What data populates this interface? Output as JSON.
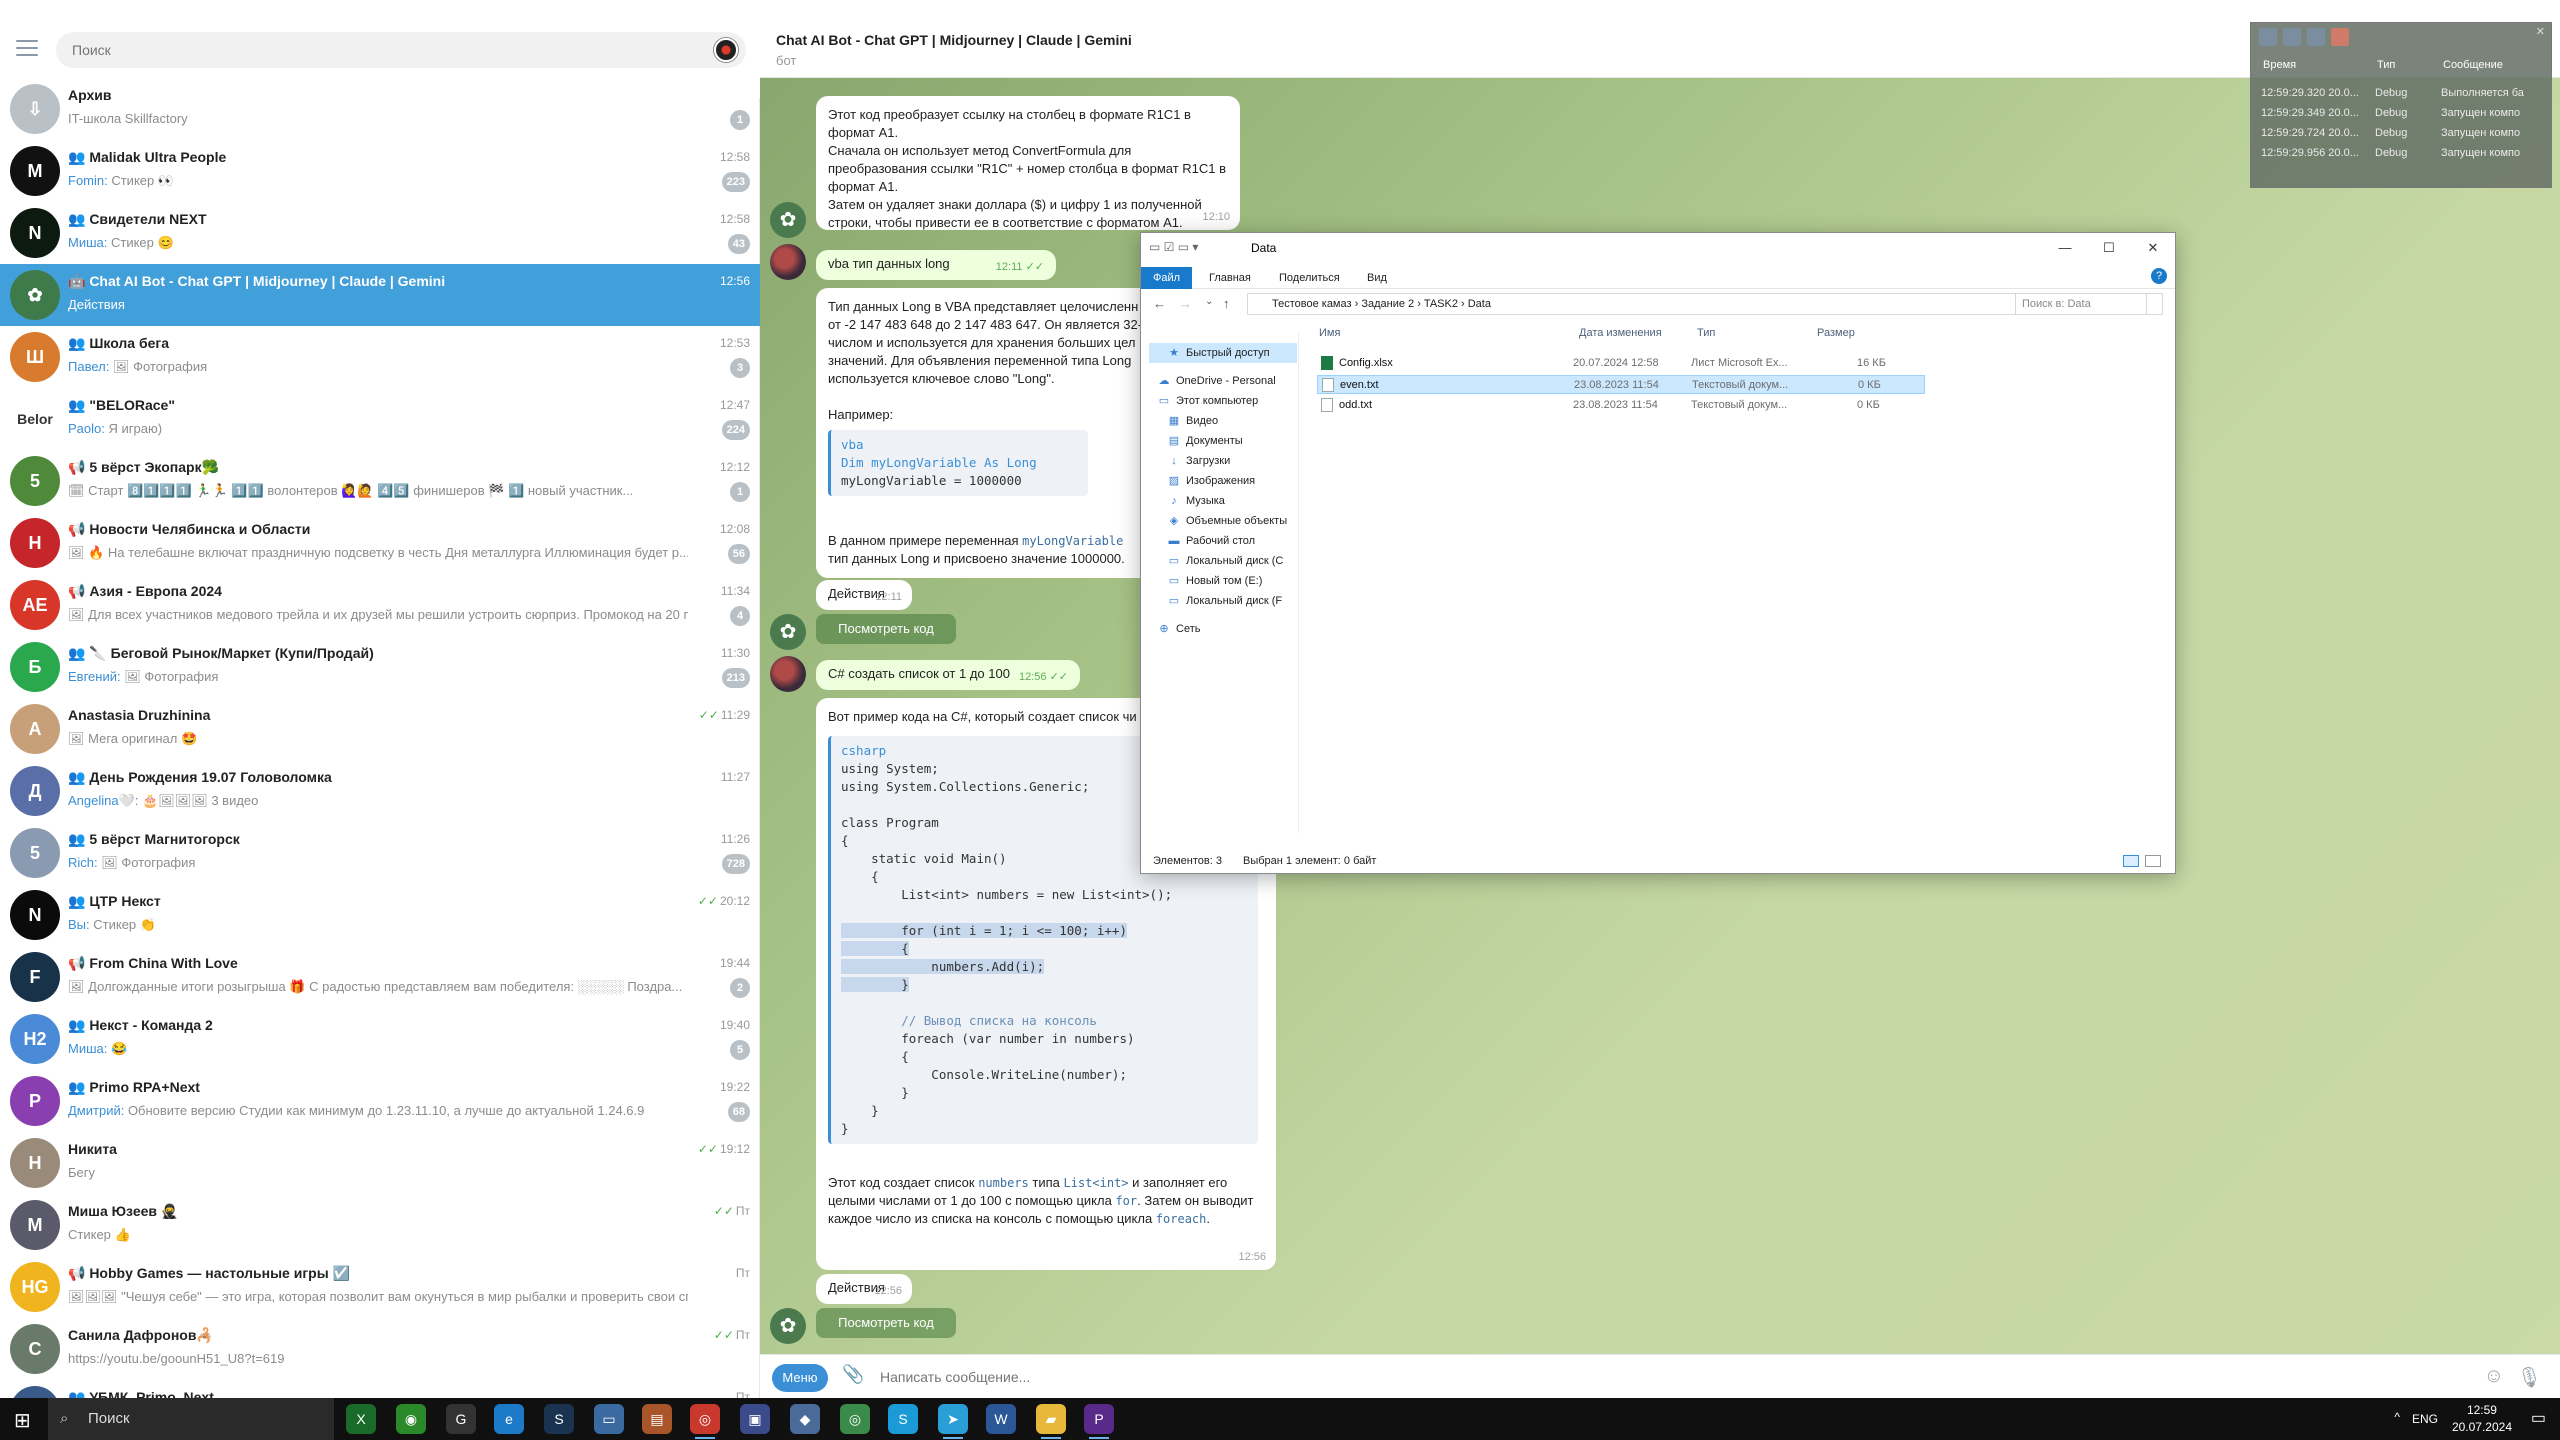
{
  "sidebar": {
    "search_placeholder": "Поиск",
    "chats": [
      {
        "name": "Архив",
        "time": "",
        "sender": "",
        "preview": "IT-школа Skillfactory",
        "badge": "1",
        "avatar_color": "#b9c1c6",
        "avatar_text": "⇩"
      },
      {
        "name": "👥 Malidak Ultra People",
        "time": "12:58",
        "sender": "Fomin: ",
        "preview": "Стикер 👀",
        "badge": "223",
        "avatar_color": "#111111",
        "avatar_text": "M"
      },
      {
        "name": "👥 Свидетели NEXT",
        "time": "12:58",
        "sender": "Миша: ",
        "preview": "Стикер 😊",
        "badge": "43",
        "avatar_color": "#0d1a10",
        "avatar_text": "N"
      },
      {
        "name": "🤖 Chat AI Bot - Chat GPT | Midjourney | Claude | Gemini",
        "time": "12:56",
        "sender": "",
        "preview": "Действия",
        "badge": "",
        "avatar_color": "#3e7a4a",
        "avatar_text": "✿",
        "active": true
      },
      {
        "name": "👥 Школа бега",
        "time": "12:53",
        "sender": "Павел: ",
        "preview": "🖼 Фотография",
        "badge": "3",
        "avatar_color": "#d97b2e",
        "avatar_text": "Ш"
      },
      {
        "name": "👥 \"BELORace\"",
        "time": "12:47",
        "sender": "Paolo: ",
        "preview": "Я играю)",
        "badge": "224",
        "avatar_color": "#ffffff",
        "avatar_text": "Belor"
      },
      {
        "name": "📢 5 вёрст Экопарк🥦",
        "time": "12:12",
        "sender": "",
        "preview": "🗓 Старт 8️⃣1️⃣1️⃣1️⃣ 🏃‍♂️🏃 1️⃣1️⃣ волонтеров 🙋‍♀️🙋 4️⃣5️⃣ финишеров 🏁 1️⃣ новый участник...",
        "badge": "1",
        "avatar_color": "#4f8a3a",
        "avatar_text": "5"
      },
      {
        "name": "📢 Новости Челябинска и Области",
        "time": "12:08",
        "sender": "",
        "preview": "🖼 🔥 На телебашне включат праздничную подсветку в честь Дня металлурга  Иллюминация будет р...",
        "badge": "56",
        "avatar_color": "#c4262a",
        "avatar_text": "Н"
      },
      {
        "name": "📢 Азия - Европа 2024",
        "time": "11:34",
        "sender": "",
        "preview": "🖼 Для всех участников медового трейла и их друзей мы решили устроить сюрприз. Промокод на 20 п...",
        "badge": "4",
        "avatar_color": "#d9362a",
        "avatar_text": "AE"
      },
      {
        "name": "👥 🔪 Беговой Рынок/Маркет (Купи/Продай)",
        "time": "11:30",
        "sender": "Евгений: ",
        "preview": "🖼 Фотография",
        "badge": "213",
        "avatar_color": "#2aa84e",
        "avatar_text": "Б"
      },
      {
        "name": "Anastasia Druzhinina",
        "time": "11:29",
        "sender": "",
        "preview": "🖼 Мега оригинал 🤩",
        "badge": "",
        "avatar_color": "#c7a07a",
        "avatar_text": "A",
        "read": true
      },
      {
        "name": "👥 День Рождения 19.07 Головоломка",
        "time": "11:27",
        "sender": "Angelina🤍: ",
        "preview": "🎂🖼🖼🖼 3 видео",
        "badge": "",
        "avatar_color": "#5a6ea8",
        "avatar_text": "Д"
      },
      {
        "name": "👥 5 вёрст Магнитогорск",
        "time": "11:26",
        "sender": "Rich: ",
        "preview": "🖼 Фотография",
        "badge": "728",
        "avatar_color": "#8a9ab0",
        "avatar_text": "5"
      },
      {
        "name": "👥 ЦТР Некст",
        "time": "20:12",
        "sender": "Вы: ",
        "preview": "Стикер 👏",
        "badge": "",
        "avatar_color": "#0b0b0b",
        "avatar_text": "N",
        "read": true
      },
      {
        "name": "📢 From China With Love",
        "time": "19:44",
        "sender": "",
        "preview": "🖼 Долгожданные итоги розыгрыша 🎁 С радостью представляем вам победителя: ░░░░░ Поздра...",
        "badge": "2",
        "avatar_color": "#18324a",
        "avatar_text": "F"
      },
      {
        "name": "👥 Некст - Команда 2",
        "time": "19:40",
        "sender": "Миша: ",
        "preview": "😂",
        "badge": "5",
        "avatar_color": "#4a8ad6",
        "avatar_text": "Н2"
      },
      {
        "name": "👥 Primo RPA+Next",
        "time": "19:22",
        "sender": "Дмитрий: ",
        "preview": "Обновите версию Студии как минимум до 1.23.11.10, а лучше до актуальной 1.24.6.9",
        "badge": "68",
        "avatar_color": "#8a3fb0",
        "avatar_text": "P"
      },
      {
        "name": "Никита",
        "time": "19:12",
        "sender": "",
        "preview": "Бегу",
        "badge": "",
        "avatar_color": "#9a8a7a",
        "avatar_text": "Н",
        "read": true
      },
      {
        "name": "Миша Юзеев 🥷",
        "time": "Пт",
        "sender": "",
        "preview": "Стикер 👍",
        "badge": "",
        "avatar_color": "#5a5a6a",
        "avatar_text": "М",
        "read": true
      },
      {
        "name": "📢 Hobby Games — настольные игры ☑️",
        "time": "Пт",
        "sender": "",
        "preview": "🖼🖼🖼 \"Чешуя себе\" — это игра, которая позволит вам окунуться в мир рыбалки и проверить свои спос...",
        "badge": "",
        "avatar_color": "#f0b41e",
        "avatar_text": "HG"
      },
      {
        "name": "Санила Дафронов🦂",
        "time": "Пт",
        "sender": "",
        "preview": "https://youtu.be/goounH51_U8?t=619",
        "badge": "",
        "avatar_color": "#6a7a6a",
        "avatar_text": "С",
        "read": true
      },
      {
        "name": "👥 УБМК, Primo, Next",
        "time": "Пт",
        "sender": "",
        "preview": "",
        "badge": "",
        "avatar_color": "#3a5a8a",
        "avatar_text": "У"
      }
    ]
  },
  "chat": {
    "title": "Chat AI Bot - Chat GPT | Midjourney | Claude | Gemini",
    "subtitle": "бот",
    "msg1": {
      "lines": [
        "Этот код преобразует ссылку на столбец в формате R1C1 в",
        "формат A1.",
        "Сначала он использует метод ConvertFormula для",
        "преобразования ссылки \"R1C\" + номер столбца в формат R1C1 в",
        "формат A1.",
        "Затем он удаляет знаки доллара ($) и цифру 1 из полученной",
        "строки, чтобы привести ее в соответствие с форматом A1."
      ],
      "time": "12:10"
    },
    "msg2": {
      "text": "vba тип данных long",
      "time": "12:11"
    },
    "msg3": {
      "lines": [
        "Тип данных Long в VBA представляет целочисленн",
        "от -2 147 483 648 до 2 147 483 647. Он является 32-би",
        "числом и используется для хранения больших цел",
        "значений. Для объявления переменной типа Long",
        "используется ключевое слово \"Long\"."
      ],
      "example_label": "Например:",
      "code_lang": "vba",
      "code_line1": "Dim myLongVariable As Long",
      "code_line2": "myLongVariable = 1000000",
      "after_pre": "В данном примере переменная ",
      "after_var": "myLongVariable",
      "after_line2": "тип данных Long и присвоено значение 1000000."
    },
    "actions1": {
      "label": "Действия",
      "time": "12:11"
    },
    "view_code_label": "Посмотреть код",
    "msg4": {
      "text": "C# создать список от 1 до 100",
      "time": "12:56"
    },
    "msg5": {
      "intro": "Вот пример кода на C#, который создает список чи",
      "code_lang": "csharp",
      "code_lines": [
        "using System;",
        "using System.Collections.Generic;",
        "",
        "class Program",
        "{",
        "    static void Main()",
        "    {",
        "        List<int> numbers = new List<int>();",
        "",
        "        for (int i = 1; i <= 100; i++)",
        "        {",
        "            numbers.Add(i);",
        "        }",
        "",
        "        // Вывод списка на консоль",
        "        foreach (var number in numbers)",
        "        {",
        "            Console.WriteLine(number);",
        "        }",
        "    }",
        "}"
      ],
      "out1_a": "Этот код создает список ",
      "out1_b": "numbers",
      "out1_c": " типа ",
      "out1_d": "List<int>",
      "out1_e": " и заполняет его",
      "out2_a": "целыми числами от 1 до 100 с помощью цикла ",
      "out2_b": "for",
      "out2_c": ". Затем он выводит",
      "out3_a": "каждое число из списка на консоль с помощью цикла ",
      "out3_b": "foreach",
      "out3_c": ".",
      "time": "12:56"
    },
    "actions2": {
      "label": "Действия",
      "time": "12:56"
    },
    "composer": {
      "menu_label": "Меню",
      "placeholder": "Написать сообщение..."
    }
  },
  "explorer": {
    "title": "Data",
    "ribbon": [
      "Файл",
      "Главная",
      "Поделиться",
      "Вид"
    ],
    "path": [
      "Тестовое камаз",
      "Задание 2",
      "TASK2",
      "Data"
    ],
    "search_placeholder": "Поиск в: Data",
    "columns": {
      "name": "Имя",
      "date": "Дата изменения",
      "type": "Тип",
      "size": "Размер"
    },
    "nav": [
      {
        "label": "Быстрый доступ",
        "icon": "★"
      },
      {
        "label": "OneDrive - Personal",
        "icon": "☁"
      },
      {
        "label": "Этот компьютер",
        "icon": "▭"
      },
      {
        "label": "Видео",
        "icon": "▦"
      },
      {
        "label": "Документы",
        "icon": "▤"
      },
      {
        "label": "Загрузки",
        "icon": "↓"
      },
      {
        "label": "Изображения",
        "icon": "▨"
      },
      {
        "label": "Музыка",
        "icon": "♪"
      },
      {
        "label": "Объемные объекты",
        "icon": "◈"
      },
      {
        "label": "Рабочий стол",
        "icon": "▬"
      },
      {
        "label": "Локальный диск (C",
        "icon": "▭"
      },
      {
        "label": "Новый том (E:)",
        "icon": "▭"
      },
      {
        "label": "Локальный диск (F",
        "icon": "▭"
      },
      {
        "label": "Сеть",
        "icon": "⊕"
      }
    ],
    "files": [
      {
        "name": "Config.xlsx",
        "date": "20.07.2024 12:58",
        "type": "Лист Microsoft Ex...",
        "size": "16 КБ"
      },
      {
        "name": "even.txt",
        "date": "23.08.2023 11:54",
        "type": "Текстовый докум...",
        "size": "0 КБ"
      },
      {
        "name": "odd.txt",
        "date": "23.08.2023 11:54",
        "type": "Текстовый докум...",
        "size": "0 КБ"
      }
    ],
    "status_count": "Элементов: 3",
    "status_selected": "Выбран 1 элемент: 0 байт"
  },
  "log_window": {
    "columns": [
      "Время",
      "Тип",
      "Сообщение"
    ],
    "rows": [
      {
        "time": "12:59:29.320 20.0...",
        "type": "Debug",
        "msg": "Выполняется ба"
      },
      {
        "time": "12:59:29.349 20.0...",
        "type": "Debug",
        "msg": "Запущен компо"
      },
      {
        "time": "12:59:29.724 20.0...",
        "type": "Debug",
        "msg": "Запущен компо"
      },
      {
        "time": "12:59:29.956 20.0...",
        "type": "Debug",
        "msg": "Запущен компо"
      }
    ]
  },
  "taskbar": {
    "search_label": "Поиск",
    "lang": "ENG",
    "time": "12:59",
    "date": "20.07.2024"
  }
}
